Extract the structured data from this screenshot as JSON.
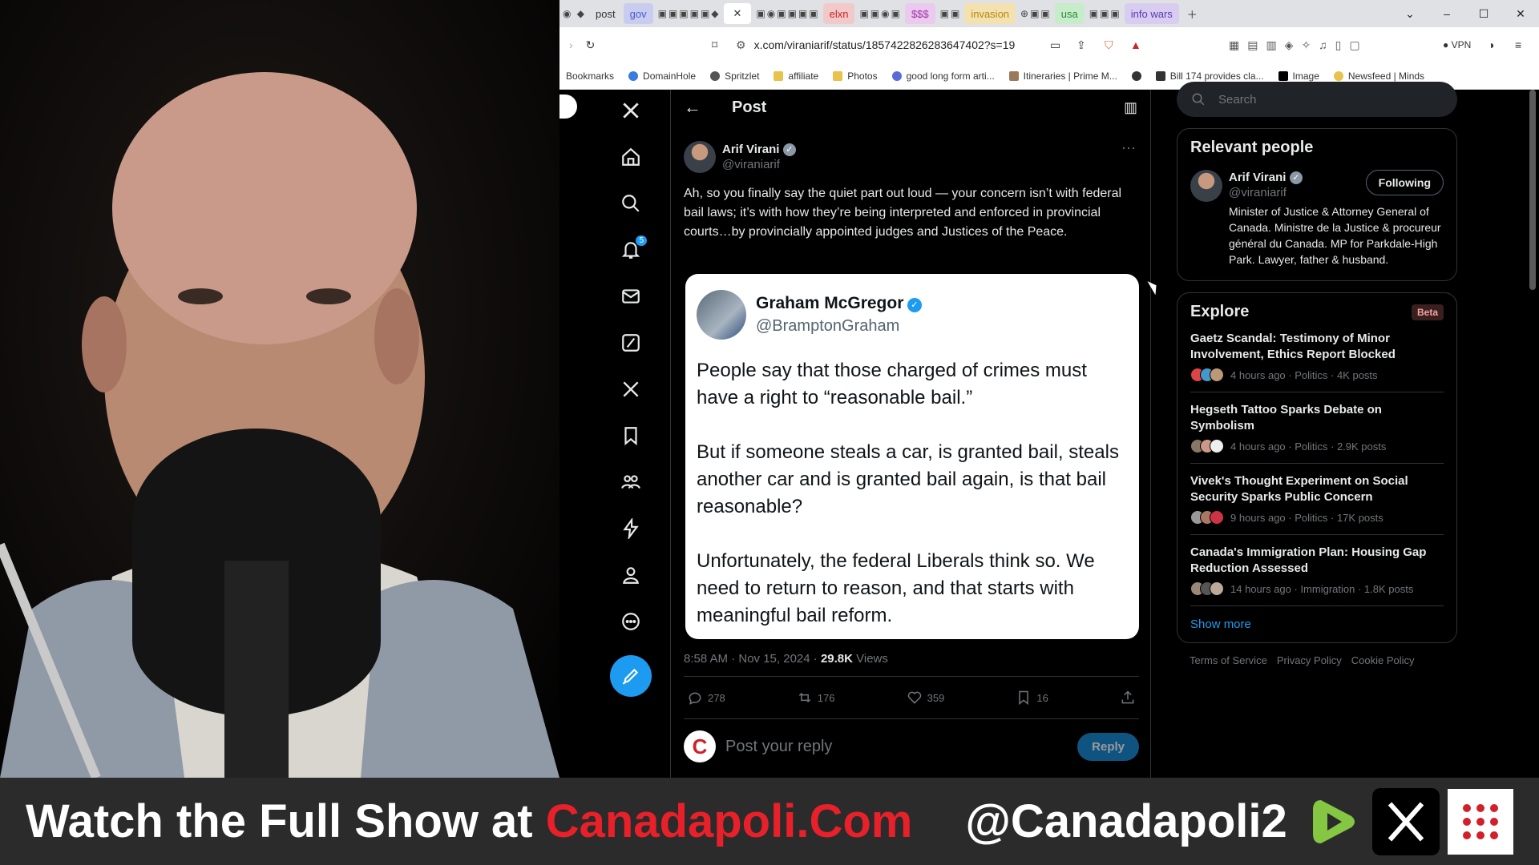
{
  "browser": {
    "tabs": [
      "post",
      "gov",
      "elxn",
      "$$$",
      "invasion",
      "usa",
      "info wars"
    ],
    "url": "x.com/viraniarif/status/1857422826283647402?s=19",
    "vpn_label": "VPN",
    "bookmarks": [
      "Bookmarks",
      "DomainHole",
      "Spritzlet",
      "affiliate",
      "Photos",
      "good long form arti...",
      "Itineraries | Prime M...",
      "Bill 174 provides cla...",
      "Image",
      "Newsfeed | Minds"
    ]
  },
  "x": {
    "header_title": "Post",
    "search_placeholder": "Search",
    "notif_count": "5",
    "post": {
      "author_name": "Arif Virani",
      "author_handle": "@viraniarif",
      "text": "Ah, so you finally say the quiet part out loud — your concern isn’t with federal bail laws; it’s with how they’re being interpreted and enforced in provincial courts…by provincially appointed judges and Justices of the Peace.",
      "quote": {
        "name": "Graham McGregor",
        "handle": "@BramptonGraham",
        "text": "People say that those charged of crimes must have a right to “reasonable bail.”\n\nBut if someone steals a car, is granted bail, steals another car and is granted bail again, is that bail reasonable?\n\nUnfortunately, the federal Liberals think so. We need to return to reason, and that starts with meaningful bail reform."
      },
      "time": "8:58 AM · Nov 15, 2024 ·",
      "views_count": "29.8K",
      "views_label": "Views",
      "replies": "278",
      "reposts": "176",
      "likes": "359",
      "bookmarks": "16",
      "reply_placeholder": "Post your reply",
      "reply_button": "Reply"
    },
    "relevant": {
      "title": "Relevant people",
      "name": "Arif Virani",
      "handle": "@viraniarif",
      "follow_label": "Following",
      "bio": "Minister of Justice & Attorney General of Canada. Ministre de la Justice & procureur général du Canada. MP for Parkdale-High Park. Lawyer, father & husband."
    },
    "explore": {
      "title": "Explore",
      "badge": "Beta",
      "trends": [
        {
          "title": "Gaetz Scandal: Testimony of Minor Involvement, Ethics Report Blocked",
          "meta": "4 hours ago · Politics · 4K posts"
        },
        {
          "title": "Hegseth Tattoo Sparks Debate on Symbolism",
          "meta": "4 hours ago · Politics · 2.9K posts"
        },
        {
          "title": "Vivek's Thought Experiment on Social Security Sparks Public Concern",
          "meta": "9 hours ago · Politics · 17K posts"
        },
        {
          "title": "Canada's Immigration Plan: Housing Gap Reduction Assessed",
          "meta": "14 hours ago · Immigration · 1.8K posts"
        }
      ],
      "show_more": "Show more"
    },
    "footer": [
      "Terms of Service",
      "Privacy Policy",
      "Cookie Policy"
    ]
  },
  "banner": {
    "prefix": "Watch the Full Show at ",
    "site": "Canadapoli.Com",
    "handle": "@Canadapoli2"
  },
  "colors": {
    "accent": "#1d9bf0",
    "site_red": "#e8202a",
    "rumble_green": "#85c742"
  }
}
